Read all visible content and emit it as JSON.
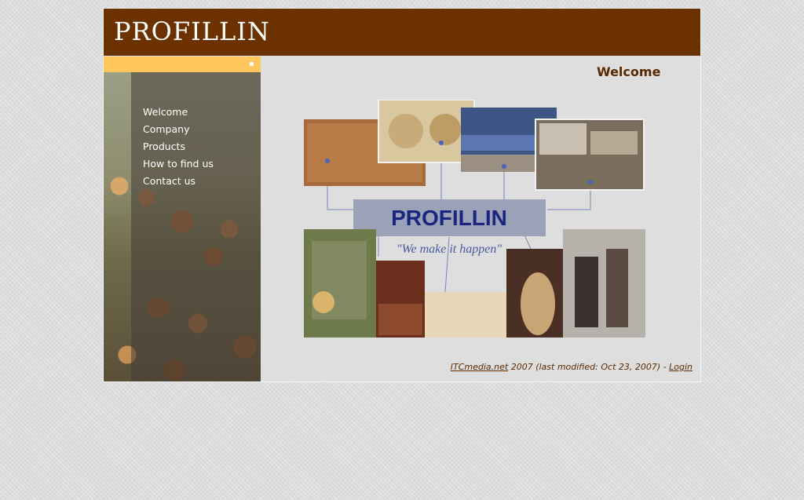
{
  "header": {
    "logo_text": "PROFILLIN"
  },
  "nav": {
    "items": [
      {
        "label": "Welcome"
      },
      {
        "label": "Company"
      },
      {
        "label": "Products"
      },
      {
        "label": "How to find us"
      },
      {
        "label": "Contact us"
      }
    ]
  },
  "main": {
    "title": "Welcome",
    "collage_brand": "PROFILLIN",
    "collage_slogan": "\"We make it happen\""
  },
  "footer": {
    "link_text": "ITCmedia.net",
    "middle_text": " 2007 (last modified: Oct 23, 2007) - ",
    "login_text": "Login"
  },
  "colors": {
    "header_bg": "#6b3200",
    "accent_strip": "#ffc75e",
    "title_text": "#5a2a00",
    "content_bg": "#dedede"
  }
}
